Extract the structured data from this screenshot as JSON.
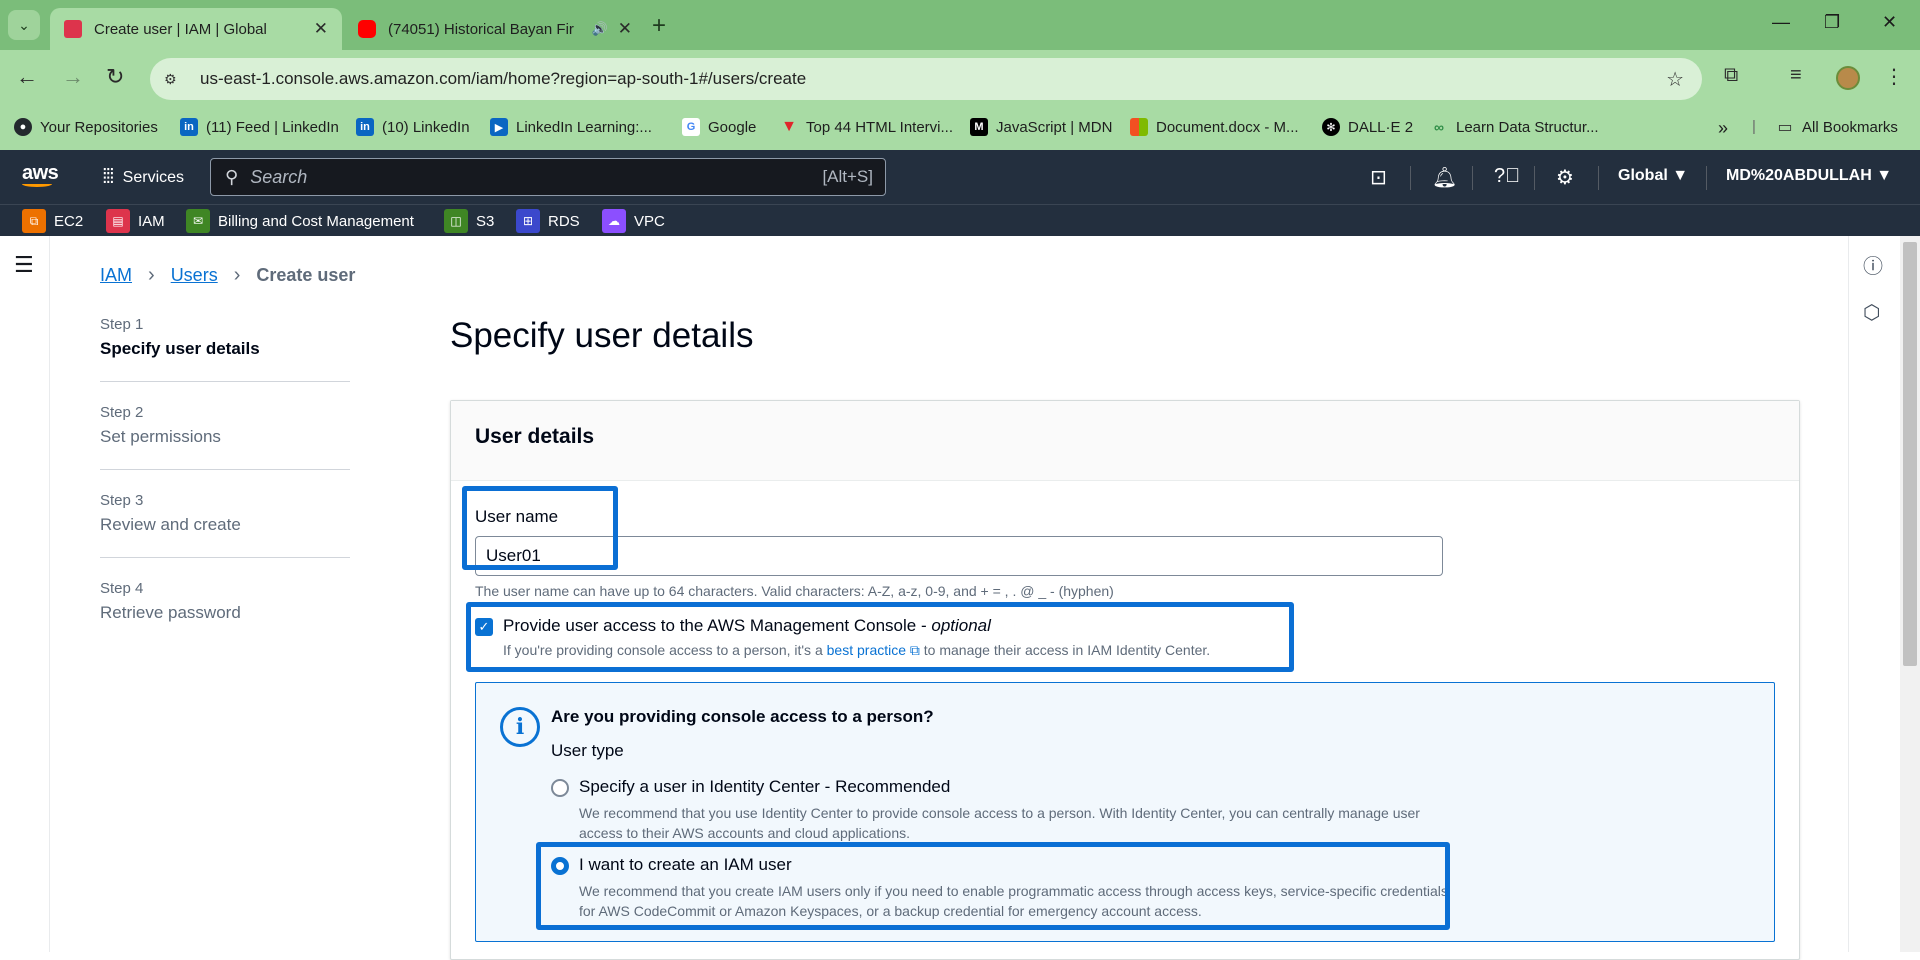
{
  "browser": {
    "tabs": [
      {
        "title": "Create user | IAM | Global",
        "active": true,
        "favicon_color": "#dd344c"
      },
      {
        "title": "(74051) Historical Bayan Fir",
        "active": false,
        "favicon_color": "#ff0000"
      }
    ],
    "url": "us-east-1.console.aws.amazon.com/iam/home?region=ap-south-1#/users/create",
    "bookmarks": [
      {
        "label": "Your Repositories",
        "icon": "github-icon"
      },
      {
        "label": "(11) Feed | LinkedIn",
        "icon": "linkedin-icon"
      },
      {
        "label": "(10) LinkedIn",
        "icon": "linkedin-icon"
      },
      {
        "label": "LinkedIn Learning:...",
        "icon": "linkedin-learning-icon"
      },
      {
        "label": "Google",
        "icon": "google-icon"
      },
      {
        "label": "Top 44 HTML Intervi...",
        "icon": "v-icon"
      },
      {
        "label": "JavaScript | MDN",
        "icon": "mdn-icon"
      },
      {
        "label": "Document.docx - M...",
        "icon": "microsoft-icon"
      },
      {
        "label": "DALL·E 2",
        "icon": "openai-icon"
      },
      {
        "label": "Learn Data Structur...",
        "icon": "gfg-icon"
      }
    ],
    "all_bookmarks": "All Bookmarks"
  },
  "aws": {
    "logo": "aws",
    "services": "Services",
    "search_placeholder": "Search",
    "search_shortcut": "[Alt+S]",
    "region": "Global ▼",
    "account": "MD%20ABDULLAH ▼",
    "favorites": [
      {
        "label": "EC2",
        "color": "#ed7100"
      },
      {
        "label": "IAM",
        "color": "#dd344c"
      },
      {
        "label": "Billing and Cost Management",
        "color": "#3f8624"
      },
      {
        "label": "S3",
        "color": "#3f8624"
      },
      {
        "label": "RDS",
        "color": "#3b48cc"
      },
      {
        "label": "VPC",
        "color": "#8c4fff"
      }
    ]
  },
  "breadcrumb": {
    "root": "IAM",
    "parent": "Users",
    "current": "Create user"
  },
  "steps": [
    {
      "num": "Step 1",
      "label": "Specify user details",
      "current": true
    },
    {
      "num": "Step 2",
      "label": "Set permissions",
      "current": false
    },
    {
      "num": "Step 3",
      "label": "Review and create",
      "current": false
    },
    {
      "num": "Step 4",
      "label": "Retrieve password",
      "current": false
    }
  ],
  "page_title": "Specify user details",
  "panel": {
    "header": "User details",
    "username_label": "User name",
    "username_value": "User01",
    "username_hint": "The user name can have up to 64 characters. Valid characters: A-Z, a-z, 0-9, and + = , . @ _ - (hyphen)",
    "console_access_label": "Provide user access to the AWS Management Console - ",
    "console_access_optional": "optional",
    "console_access_checked": true,
    "console_access_hint_pre": "If you're providing console access to a person, it's a ",
    "console_access_hint_link": "best practice",
    "console_access_hint_post": " to manage their access in IAM Identity Center.",
    "info_title": "Are you providing console access to a person?",
    "user_type_label": "User type",
    "option1_label": "Specify a user in Identity Center - Recommended",
    "option1_desc": "We recommend that you use Identity Center to provide console access to a person. With Identity Center, you can centrally manage user access to their AWS accounts and cloud applications.",
    "option2_label": "I want to create an IAM user",
    "option2_desc": "We recommend that you create IAM users only if you need to enable programmatic access through access keys, service-specific credentials for AWS CodeCommit or Amazon Keyspaces, or a backup credential for emergency account access.",
    "selected_option": "I want to create an IAM user"
  },
  "colors": {
    "aws_nav": "#232f3e",
    "aws_orange": "#ff9900",
    "link_blue": "#0972d3",
    "annotation_blue": "#0b6fd4",
    "chrome_green": "#a8dba4"
  }
}
